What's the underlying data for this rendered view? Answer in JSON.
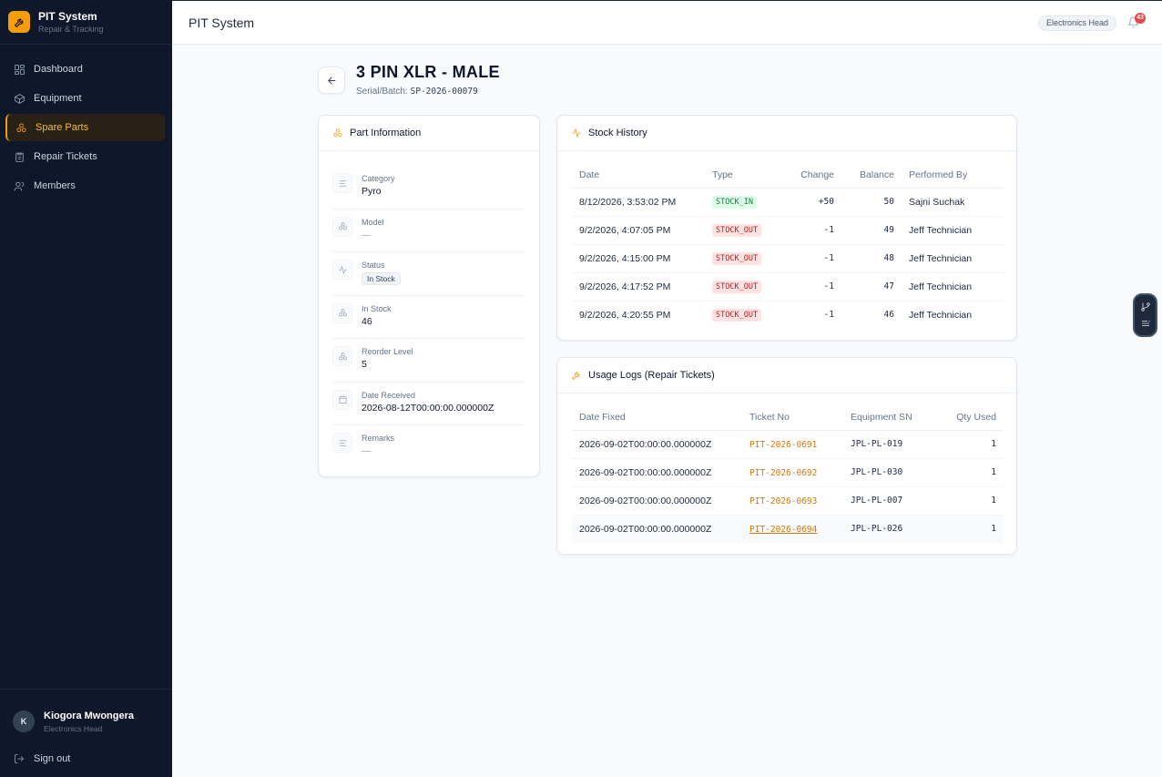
{
  "app": {
    "name": "PIT System",
    "tagline": "Repair & Tracking"
  },
  "sidebar": {
    "items": [
      {
        "label": "Dashboard",
        "icon": "dashboard-icon",
        "active": false
      },
      {
        "label": "Equipment",
        "icon": "box-icon",
        "active": false
      },
      {
        "label": "Spare Parts",
        "icon": "parts-icon",
        "active": true
      },
      {
        "label": "Repair Tickets",
        "icon": "clipboard-icon",
        "active": false
      },
      {
        "label": "Members",
        "icon": "users-icon",
        "active": false
      }
    ],
    "user": {
      "initial": "K",
      "name": "Kiogora Mwongera",
      "role": "Electronics Head"
    },
    "signout_label": "Sign out"
  },
  "topbar": {
    "title": "PIT System",
    "role": "Electronics Head",
    "notification_count": "43"
  },
  "header": {
    "title": "3 PIN XLR - MALE",
    "serial_label": "Serial/Batch:",
    "serial_value": "SP-2026-00079"
  },
  "part_info": {
    "title": "Part Information",
    "fields": [
      {
        "label": "Category",
        "value": "Pyro",
        "icon": "text-icon"
      },
      {
        "label": "Model",
        "value": "—",
        "icon": "parts-icon"
      },
      {
        "label": "Status",
        "value": "In Stock",
        "icon": "activity-icon"
      },
      {
        "label": "In Stock",
        "value": "46",
        "icon": "parts-icon"
      },
      {
        "label": "Reorder Level",
        "value": "5",
        "icon": "parts-icon"
      },
      {
        "label": "Date Received",
        "value": "2026-08-12T00:00:00.000000Z",
        "icon": "calendar-icon"
      },
      {
        "label": "Remarks",
        "value": "—",
        "icon": "text-icon"
      }
    ]
  },
  "stock_history": {
    "title": "Stock History",
    "columns": [
      "Date",
      "Type",
      "Change",
      "Balance",
      "Performed By"
    ],
    "rows": [
      [
        "8/12/2026, 3:53:02 PM",
        "STOCK_IN",
        "+50",
        "50",
        "Sajni Suchak"
      ],
      [
        "9/2/2026, 4:07:05 PM",
        "STOCK_OUT",
        "-1",
        "49",
        "Jeff Technician"
      ],
      [
        "9/2/2026, 4:15:00 PM",
        "STOCK_OUT",
        "-1",
        "48",
        "Jeff Technician"
      ],
      [
        "9/2/2026, 4:17:52 PM",
        "STOCK_OUT",
        "-1",
        "47",
        "Jeff Technician"
      ],
      [
        "9/2/2026, 4:20:55 PM",
        "STOCK_OUT",
        "-1",
        "46",
        "Jeff Technician"
      ]
    ]
  },
  "usage_logs": {
    "title": "Usage Logs (Repair Tickets)",
    "columns": [
      "Date Fixed",
      "Ticket No",
      "Equipment SN",
      "Qty Used"
    ],
    "rows": [
      [
        "2026-09-02T00:00:00.000000Z",
        "PIT-2026-0691",
        "JPL-PL-019",
        "1"
      ],
      [
        "2026-09-02T00:00:00.000000Z",
        "PIT-2026-0692",
        "JPL-PL-030",
        "1"
      ],
      [
        "2026-09-02T00:00:00.000000Z",
        "PIT-2026-0693",
        "JPL-PL-007",
        "1"
      ],
      [
        "2026-09-02T00:00:00.000000Z",
        "PIT-2026-0694",
        "JPL-PL-026",
        "1"
      ]
    ]
  },
  "colors": {
    "accent": "#f59e0b",
    "sidebar_bg": "#0f172a",
    "stock_in": "#15803d",
    "stock_out": "#b91c1c"
  }
}
